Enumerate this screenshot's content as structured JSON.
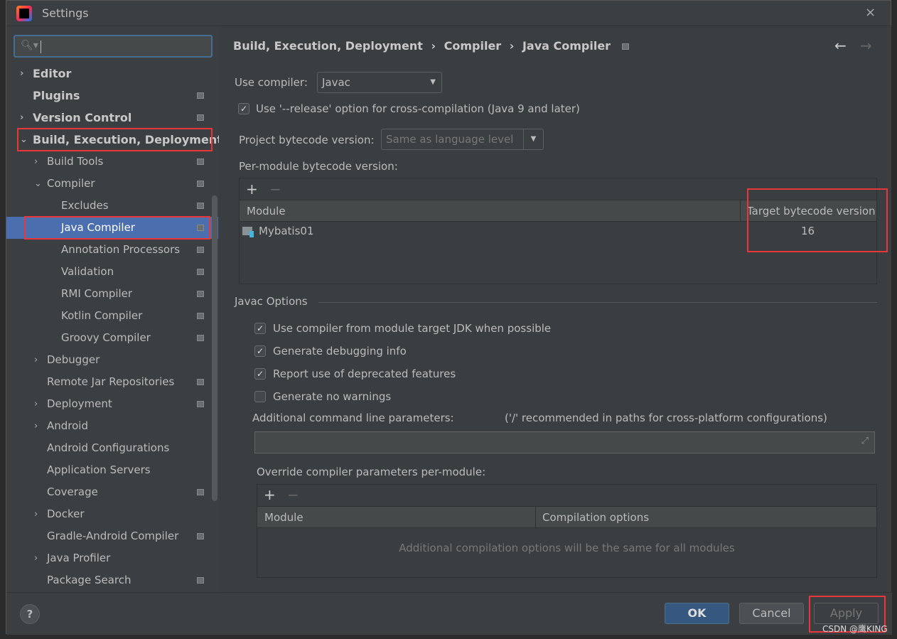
{
  "window": {
    "title": "Settings",
    "close": "×"
  },
  "search": {
    "placeholder": "",
    "icon": "search-icon"
  },
  "sidebar": {
    "items": [
      {
        "label": "Editor",
        "level": 0,
        "chev": "›",
        "bold": true,
        "mark": false
      },
      {
        "label": "Plugins",
        "level": 0,
        "chev": "",
        "bold": true,
        "mark": true
      },
      {
        "label": "Version Control",
        "level": 0,
        "chev": "›",
        "bold": true,
        "mark": true
      },
      {
        "label": "Build, Execution, Deployment",
        "level": 0,
        "chev": "⌄",
        "bold": true,
        "mark": false,
        "red": true
      },
      {
        "label": "Build Tools",
        "level": 1,
        "chev": "›",
        "mark": true
      },
      {
        "label": "Compiler",
        "level": 1,
        "chev": "⌄",
        "mark": true
      },
      {
        "label": "Excludes",
        "level": 2,
        "chev": "",
        "mark": true
      },
      {
        "label": "Java Compiler",
        "level": 2,
        "chev": "",
        "mark": true,
        "selected": true,
        "red": true
      },
      {
        "label": "Annotation Processors",
        "level": 2,
        "chev": "",
        "mark": true
      },
      {
        "label": "Validation",
        "level": 2,
        "chev": "",
        "mark": true
      },
      {
        "label": "RMI Compiler",
        "level": 2,
        "chev": "",
        "mark": true
      },
      {
        "label": "Kotlin Compiler",
        "level": 2,
        "chev": "",
        "mark": true
      },
      {
        "label": "Groovy Compiler",
        "level": 2,
        "chev": "",
        "mark": true
      },
      {
        "label": "Debugger",
        "level": 1,
        "chev": "›",
        "mark": false
      },
      {
        "label": "Remote Jar Repositories",
        "level": 1,
        "chev": "",
        "mark": true
      },
      {
        "label": "Deployment",
        "level": 1,
        "chev": "›",
        "mark": true
      },
      {
        "label": "Android",
        "level": 1,
        "chev": "›",
        "mark": false
      },
      {
        "label": "Android Configurations",
        "level": 1,
        "chev": "",
        "mark": false
      },
      {
        "label": "Application Servers",
        "level": 1,
        "chev": "",
        "mark": false
      },
      {
        "label": "Coverage",
        "level": 1,
        "chev": "",
        "mark": true
      },
      {
        "label": "Docker",
        "level": 1,
        "chev": "›",
        "mark": false
      },
      {
        "label": "Gradle-Android Compiler",
        "level": 1,
        "chev": "",
        "mark": true
      },
      {
        "label": "Java Profiler",
        "level": 1,
        "chev": "›",
        "mark": false
      },
      {
        "label": "Package Search",
        "level": 1,
        "chev": "",
        "mark": true
      }
    ]
  },
  "breadcrumb": {
    "parts": [
      "Build, Execution, Deployment",
      "Compiler",
      "Java Compiler"
    ],
    "sep": "›",
    "back": "←",
    "forward": "→"
  },
  "compiler": {
    "label": "Use compiler:",
    "value": "Javac"
  },
  "release": {
    "label": "Use '--release' option for cross-compilation (Java 9 and later)",
    "checked": true
  },
  "project_bytecode": {
    "label": "Project bytecode version:",
    "value": "Same as language level"
  },
  "per_module": {
    "label": "Per-module bytecode version:",
    "add": "+",
    "remove": "−",
    "columns": [
      "Module",
      "Target bytecode version"
    ],
    "rows": [
      {
        "module": "Mybatis01",
        "version": "16"
      }
    ]
  },
  "javac": {
    "section": "Javac Options",
    "options": [
      {
        "label": "Use compiler from module target JDK when possible",
        "checked": true
      },
      {
        "label": "Generate debugging info",
        "checked": true
      },
      {
        "label": "Report use of deprecated features",
        "checked": true
      },
      {
        "label": "Generate no warnings",
        "checked": false
      }
    ],
    "additional_label": "Additional command line parameters:",
    "additional_hint": "('/' recommended in paths for cross-platform configurations)",
    "additional_value": "",
    "override_label": "Override compiler parameters per-module:",
    "override_columns": [
      "Module",
      "Compilation options"
    ],
    "override_empty": "Additional compilation options will be the same for all modules"
  },
  "footer": {
    "help": "?",
    "ok": "OK",
    "cancel": "Cancel",
    "apply": "Apply",
    "watermark": "CSDN @鹰KING"
  },
  "colors": {
    "accent": "#4b6eaf",
    "highlight": "#e8373b",
    "ok": "#365880"
  }
}
